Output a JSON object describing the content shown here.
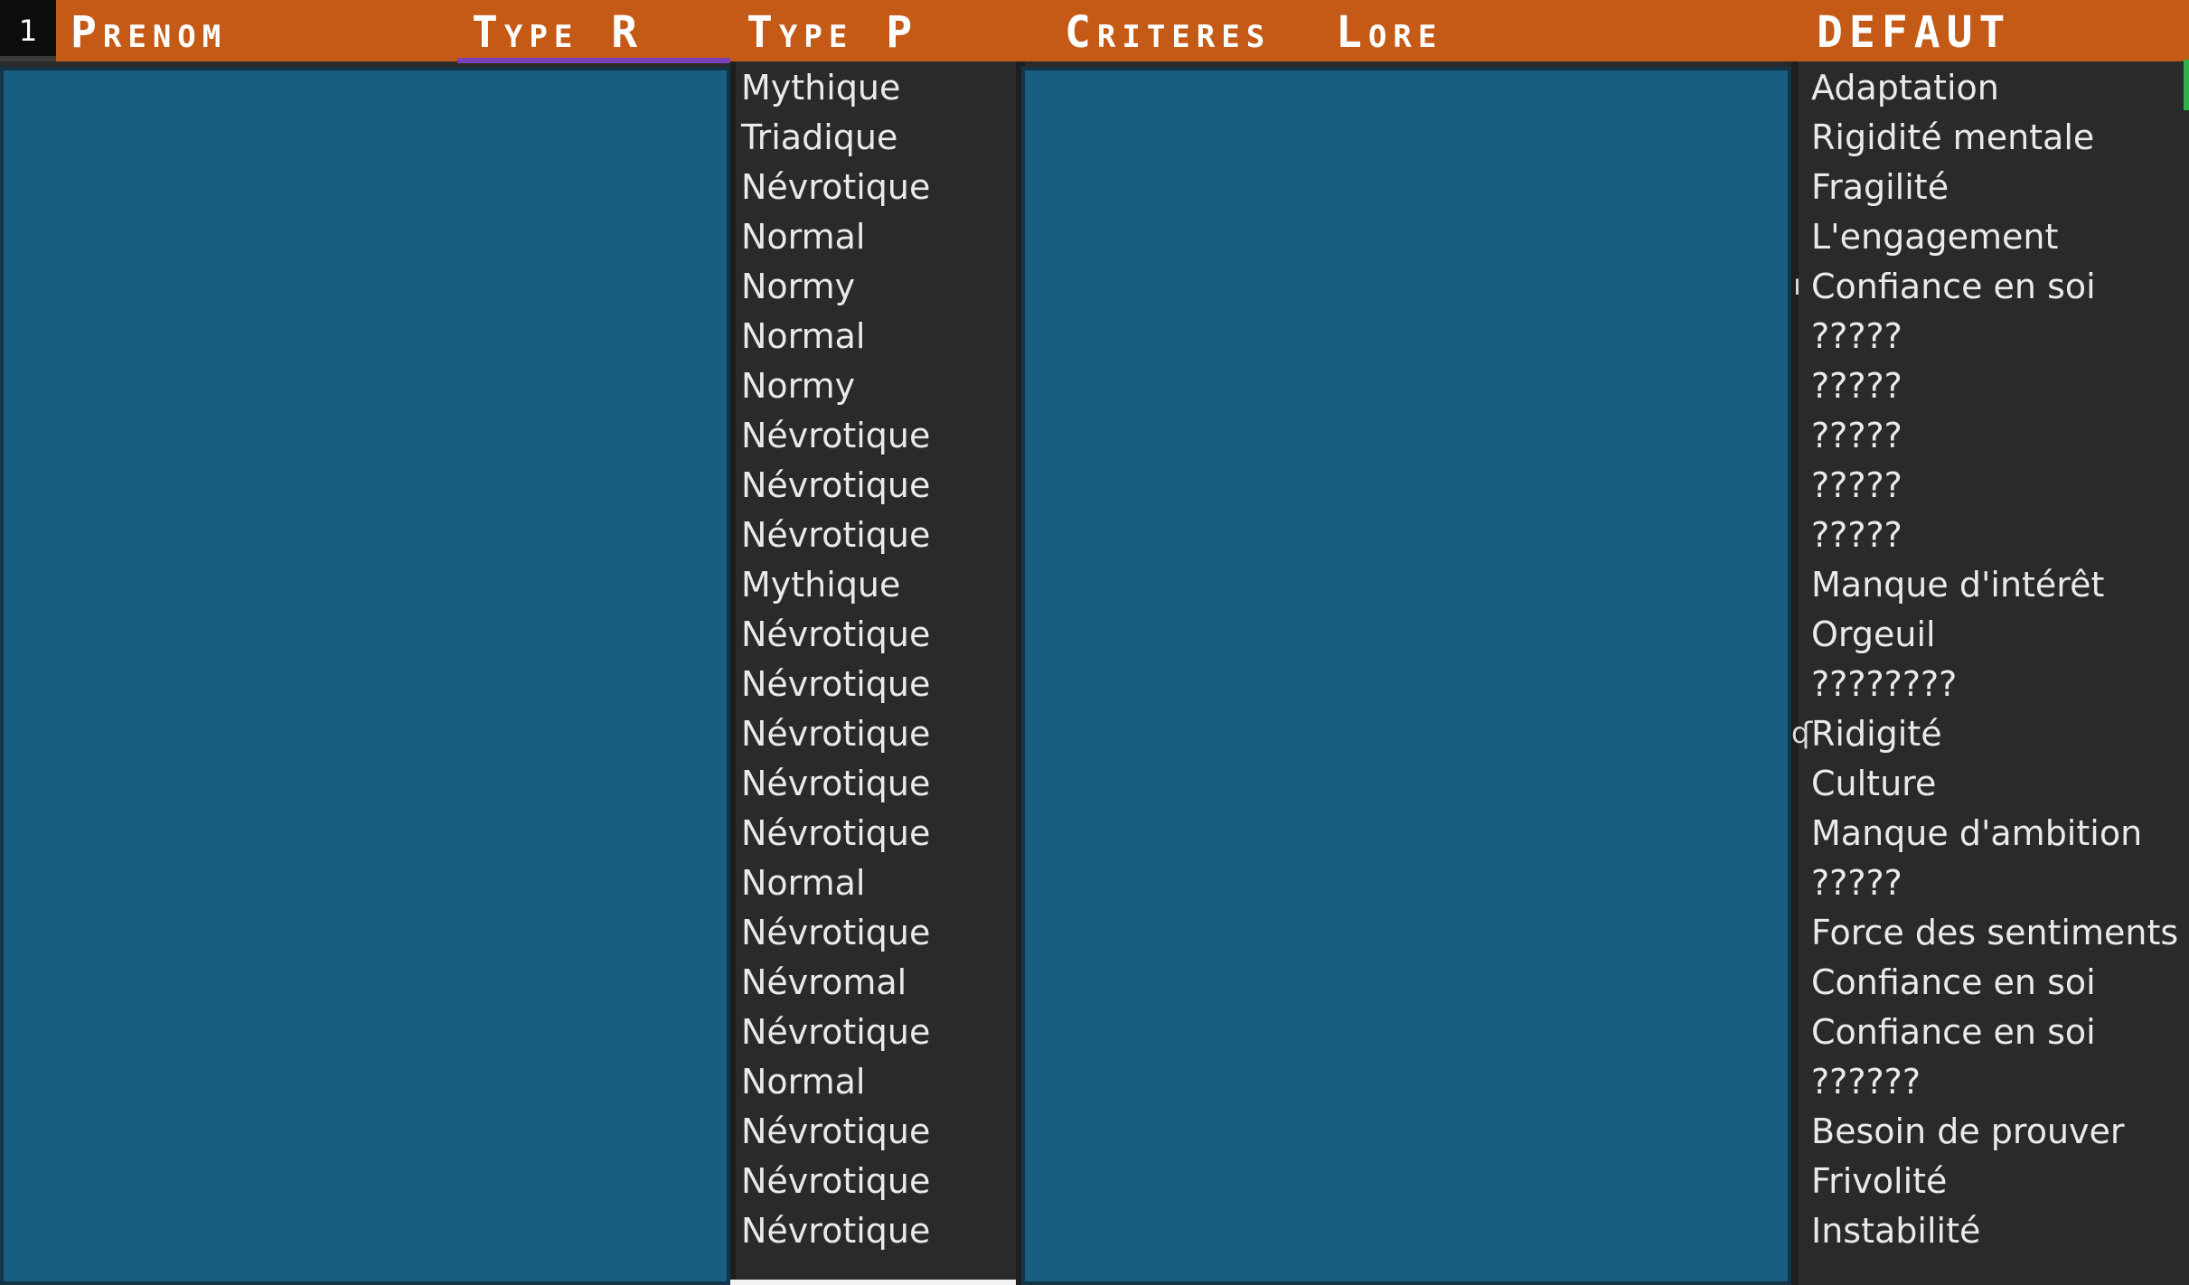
{
  "header": {
    "row_number": "1",
    "columns": {
      "prenom": "Prenom",
      "type_r": "Type R",
      "type_p": "Type P",
      "criteres_lore": "Criteres  Lore",
      "defaut": "DEFAUT"
    }
  },
  "type_p_values": [
    "Mythique",
    "Triadique",
    "Névrotique",
    "Normal",
    "Normy",
    "Normal",
    "Normy",
    "Névrotique",
    "Névrotique",
    "Névrotique",
    "Mythique",
    "Névrotique",
    "Névrotique",
    "Névrotique",
    "Névrotique",
    "Névrotique",
    "Normal",
    "Névrotique",
    "Névromal",
    "Névrotique",
    "Normal",
    "Névrotique",
    "Névrotique",
    "Névrotique"
  ],
  "defaut_values": [
    "Adaptation",
    "Rigidité mentale",
    "Fragilité",
    "L'engagement",
    "Confiance en soi",
    "?????",
    "?????",
    "?????",
    "?????",
    "?????",
    "Manque d'intérêt",
    "Orgeuil",
    "????????",
    "Ridigité",
    "Culture",
    "Manque d'ambition",
    "?????",
    "Force des sentiments",
    "Confiance en soi",
    "Confiance en soi",
    "??????",
    "Besoin de prouver",
    "Frivolité",
    "Instabilité"
  ],
  "overflow_glyphs": {
    "row5": "ı",
    "row14": "ʠ"
  },
  "colors": {
    "header_bg": "#c45a16",
    "panel_bg": "#175e80",
    "panel_border": "#143548",
    "body_bg": "#2a2a2a",
    "type_r_accent": "#7b3fb7",
    "selection_mark": "#2fb04a"
  }
}
